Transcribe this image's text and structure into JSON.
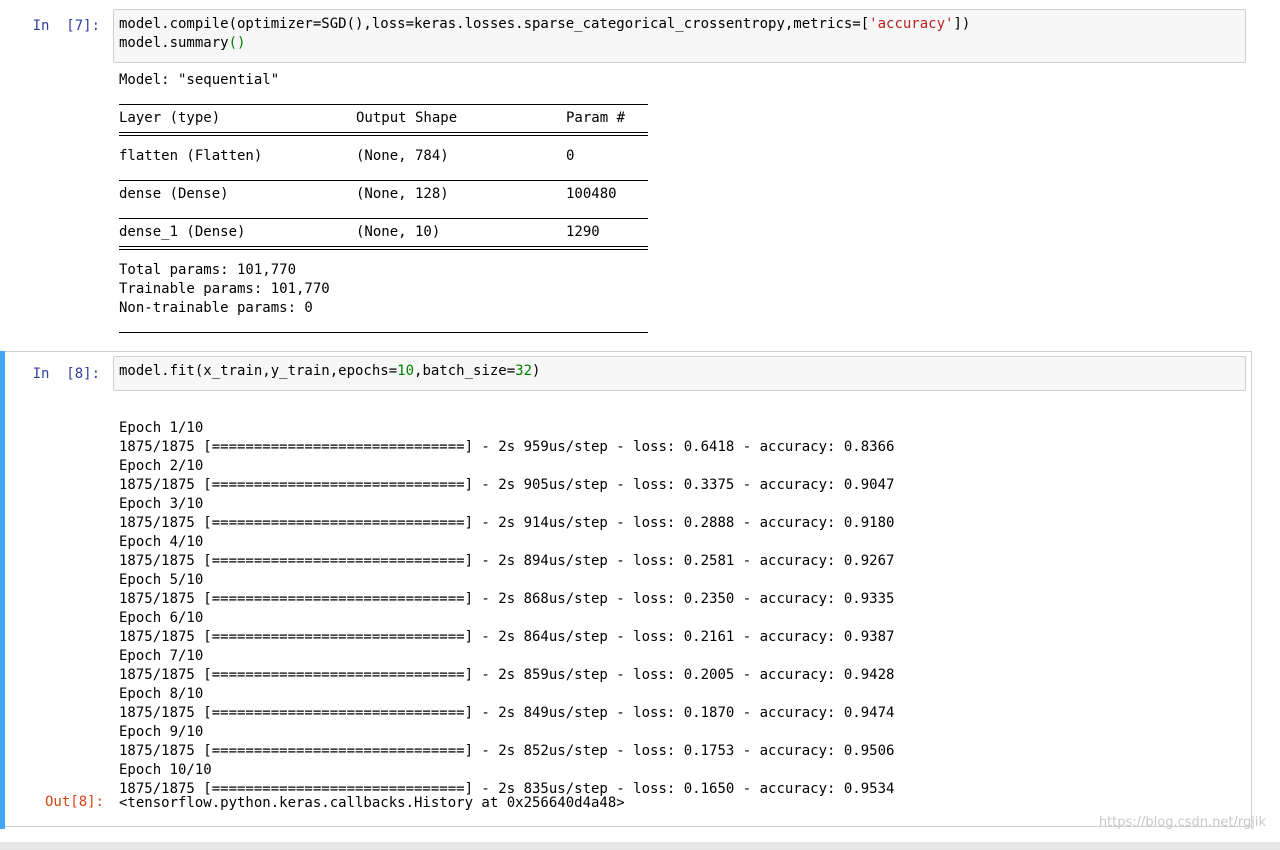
{
  "cell7": {
    "prompt": "In  [7]:",
    "code_line1_parts": [
      "model.compile(optimizer=SGD(),loss=keras.losses.sparse_categorical_crossentropy,metrics=[",
      "'accuracy'",
      "])"
    ],
    "code_line2_parts": [
      "model.summary",
      "()"
    ],
    "model_title": "Model: \"sequential\"",
    "summary_header": [
      "Layer (type)",
      "Output Shape",
      "Param #"
    ],
    "summary_rows": [
      [
        "flatten (Flatten)",
        "(None, 784)",
        "0"
      ],
      [
        "dense (Dense)",
        "(None, 128)",
        "100480"
      ],
      [
        "dense_1 (Dense)",
        "(None, 10)",
        "1290"
      ]
    ],
    "totals": [
      "Total params: 101,770",
      "Trainable params: 101,770",
      "Non-trainable params: 0"
    ]
  },
  "cell8": {
    "prompt": "In  [8]:",
    "code_parts": [
      "model.fit(x_train,y_train,epochs=",
      "10",
      ",batch_size=",
      "32",
      ")"
    ],
    "epochs": [
      [
        "Epoch 1/10",
        "1875/1875 [==============================] - 2s 959us/step - loss: 0.6418 - accuracy: 0.8366"
      ],
      [
        "Epoch 2/10",
        "1875/1875 [==============================] - 2s 905us/step - loss: 0.3375 - accuracy: 0.9047"
      ],
      [
        "Epoch 3/10",
        "1875/1875 [==============================] - 2s 914us/step - loss: 0.2888 - accuracy: 0.9180"
      ],
      [
        "Epoch 4/10",
        "1875/1875 [==============================] - 2s 894us/step - loss: 0.2581 - accuracy: 0.9267"
      ],
      [
        "Epoch 5/10",
        "1875/1875 [==============================] - 2s 868us/step - loss: 0.2350 - accuracy: 0.9335"
      ],
      [
        "Epoch 6/10",
        "1875/1875 [==============================] - 2s 864us/step - loss: 0.2161 - accuracy: 0.9387"
      ],
      [
        "Epoch 7/10",
        "1875/1875 [==============================] - 2s 859us/step - loss: 0.2005 - accuracy: 0.9428"
      ],
      [
        "Epoch 8/10",
        "1875/1875 [==============================] - 2s 849us/step - loss: 0.1870 - accuracy: 0.9474"
      ],
      [
        "Epoch 9/10",
        "1875/1875 [==============================] - 2s 852us/step - loss: 0.1753 - accuracy: 0.9506"
      ],
      [
        "Epoch 10/10",
        "1875/1875 [==============================] - 2s 835us/step - loss: 0.1650 - accuracy: 0.9534"
      ]
    ],
    "out_prompt": "Out[8]:",
    "result": "<tensorflow.python.keras.callbacks.History at 0x256640d4a48>"
  },
  "watermark": "https://blog.csdn.net/rgjik",
  "colors": {
    "prompt_in": "#303f9f",
    "prompt_out": "#d84315",
    "selected_bar": "#42a5f5",
    "string": "#ba2121",
    "number": "#008000"
  }
}
